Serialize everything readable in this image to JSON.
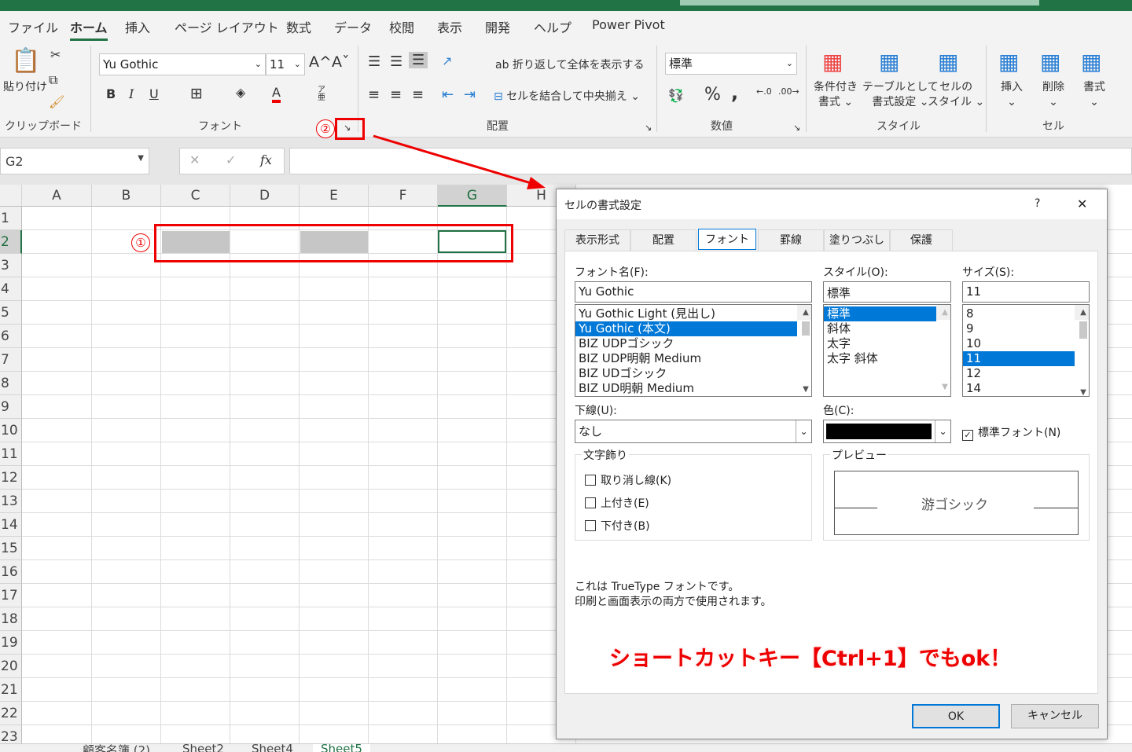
{
  "ribbon_tabs": [
    "ファイル",
    "ホーム",
    "挿入",
    "ページ レイアウト",
    "数式",
    "データ",
    "校閲",
    "表示",
    "開発",
    "ヘルプ",
    "Power Pivot"
  ],
  "active_tab": "ホーム",
  "clipboard": {
    "paste": "貼り付け",
    "group": "クリップボード"
  },
  "font": {
    "name": "Yu Gothic",
    "size": "11",
    "group": "フォント",
    "bold": "B",
    "italic": "I",
    "underline": "U",
    "color": "A",
    "grow": "A^",
    "shrink": "Aˇ",
    "furigana": "ア亜"
  },
  "alignment": {
    "wrap": "折り返して全体を表示する",
    "merge": "セルを結合して中央揃え",
    "group": "配置"
  },
  "number": {
    "format": "標準",
    "percent": "%",
    "comma": ",",
    "group": "数値"
  },
  "styles": {
    "conditional": [
      "条件付き",
      "書式"
    ],
    "table": [
      "テーブルとして",
      "書式設定"
    ],
    "cell": [
      "セルの",
      "スタイル"
    ],
    "group": "スタイル"
  },
  "cells": {
    "insert": "挿入",
    "delete": "削除",
    "format": "書式",
    "group": "セル"
  },
  "name_box": "G2",
  "fx": "fx",
  "columns": [
    "A",
    "B",
    "C",
    "D",
    "E",
    "F",
    "G",
    "H"
  ],
  "rows": [
    "1",
    "2",
    "3",
    "4",
    "5",
    "6",
    "7",
    "8",
    "9",
    "10",
    "11",
    "12",
    "13",
    "14",
    "15",
    "16",
    "17",
    "18",
    "19",
    "20",
    "21",
    "22",
    "23"
  ],
  "sheet_tabs": [
    "顧客名簿 (2)",
    "Sheet2",
    "Sheet4",
    "Sheet5"
  ],
  "active_sheet": "Sheet5",
  "annotations": {
    "one": "①",
    "two": "②",
    "shortcut": "ショートカットキー【Ctrl+1】でもok！",
    "accent": "#e00000"
  },
  "dialog": {
    "title": "セルの書式設定",
    "help": "?",
    "close": "✕",
    "tabs": [
      "表示形式",
      "配置",
      "フォント",
      "罫線",
      "塗りつぶし",
      "保護"
    ],
    "active_tab": "フォント",
    "font_label": "フォント名(F):",
    "font_value": "Yu Gothic",
    "font_list": [
      "Yu Gothic Light (見出し)",
      "Yu Gothic (本文)",
      "BIZ UDPゴシック",
      "BIZ UDP明朝 Medium",
      "BIZ UDゴシック",
      "BIZ UD明朝 Medium"
    ],
    "font_selected": 1,
    "style_label": "スタイル(O):",
    "style_value": "標準",
    "style_list": [
      "標準",
      "斜体",
      "太字",
      "太字 斜体"
    ],
    "size_label": "サイズ(S):",
    "size_value": "11",
    "size_list": [
      "8",
      "9",
      "10",
      "11",
      "12",
      "14"
    ],
    "underline_label": "下線(U):",
    "underline_value": "なし",
    "color_label": "色(C):",
    "color_value": "#000000",
    "normal_font": "標準フォント(N)",
    "normal_font_checked": true,
    "effects_label": "文字飾り",
    "effects": [
      "取り消し線(K)",
      "上付き(E)",
      "下付き(B)"
    ],
    "preview_label": "プレビュー",
    "preview_text": "游ゴシック",
    "info": [
      "これは TrueType フォントです。",
      "印刷と画面表示の両方で使用されます。"
    ],
    "ok": "OK",
    "cancel": "キャンセル"
  }
}
